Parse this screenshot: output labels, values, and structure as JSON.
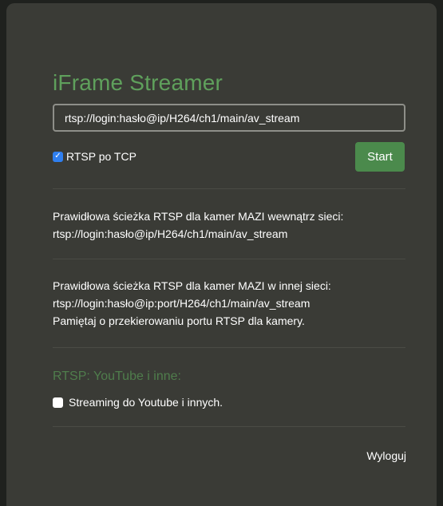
{
  "app": {
    "title": "iFrame Streamer"
  },
  "stream_form": {
    "url_value": "rtsp://login:hasło@ip/H264/ch1/main/av_stream",
    "rtsp_tcp_label": "RTSP po TCP",
    "rtsp_tcp_checked": true,
    "start_label": "Start"
  },
  "info_local": {
    "line1": "Prawidłowa ścieżka RTSP dla kamer MAZI wewnątrz sieci:",
    "line2": "rtsp://login:hasło@ip/H264/ch1/main/av_stream"
  },
  "info_remote": {
    "line1": "Prawidłowa ścieżka RTSP dla kamer MAZI w innej sieci:",
    "line2": "rtsp://login:hasło@ip:port/H264/ch1/main/av_stream",
    "line3": "Pamiętaj o przekierowaniu portu RTSP dla kamery."
  },
  "youtube_section": {
    "title": "RTSP: YouTube i inne:",
    "checkbox_label": "Streaming do Youtube i innych.",
    "checkbox_checked": false
  },
  "footer": {
    "logout_label": "Wyloguj"
  },
  "colors": {
    "panel_bg": "#3a3b36",
    "accent_green": "#5fa05c",
    "button_green": "#4b8a4c",
    "checkbox_blue": "#2f7ff0"
  }
}
